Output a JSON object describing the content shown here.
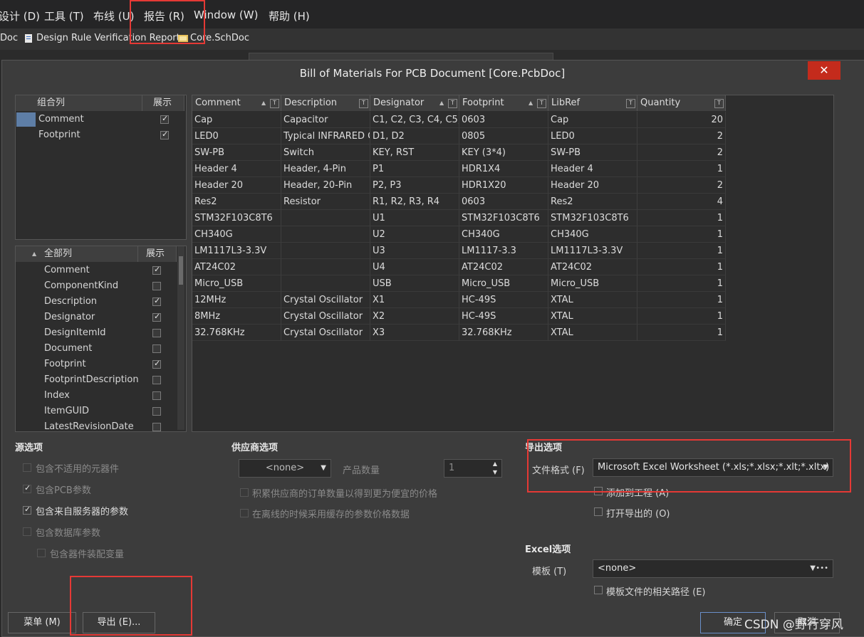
{
  "menubar": {
    "items": [
      "设计 (D)",
      "工具 (T)",
      "布线 (U)",
      "报告 (R)",
      "Window (W)",
      "帮助 (H)"
    ]
  },
  "tabs": [
    "Doc",
    "Design Rule Verification Report",
    "Core.SchDoc"
  ],
  "dialog": {
    "title": "Bill of Materials For PCB Document [Core.PcbDoc]",
    "close": "✕"
  },
  "grouped_columns": {
    "header_col": "组合列",
    "header_show": "展示",
    "items": [
      {
        "label": "Comment",
        "checked": true
      },
      {
        "label": "Footprint",
        "checked": true
      }
    ]
  },
  "all_columns": {
    "header_col": "全部列",
    "header_show": "展示",
    "items": [
      {
        "label": "Comment",
        "checked": true
      },
      {
        "label": "ComponentKind",
        "checked": false
      },
      {
        "label": "Description",
        "checked": true
      },
      {
        "label": "Designator",
        "checked": true
      },
      {
        "label": "DesignItemId",
        "checked": false
      },
      {
        "label": "Document",
        "checked": false
      },
      {
        "label": "Footprint",
        "checked": true
      },
      {
        "label": "FootprintDescription",
        "checked": false
      },
      {
        "label": "Index",
        "checked": false
      },
      {
        "label": "ItemGUID",
        "checked": false
      },
      {
        "label": "LatestRevisionDate",
        "checked": false
      }
    ]
  },
  "bom_table": {
    "columns": [
      "Comment",
      "Description",
      "Designator",
      "Footprint",
      "LibRef",
      "Quantity"
    ],
    "rows": [
      [
        "Cap",
        "Capacitor",
        "C1, C2, C3, C4, C5,",
        "0603",
        "Cap",
        "20"
      ],
      [
        "LED0",
        "Typical INFRARED G",
        "D1, D2",
        "0805",
        "LED0",
        "2"
      ],
      [
        "SW-PB",
        "Switch",
        "KEY, RST",
        "KEY (3*4)",
        "SW-PB",
        "2"
      ],
      [
        "Header 4",
        "Header, 4-Pin",
        "P1",
        "HDR1X4",
        "Header 4",
        "1"
      ],
      [
        "Header 20",
        "Header, 20-Pin",
        "P2, P3",
        "HDR1X20",
        "Header 20",
        "2"
      ],
      [
        "Res2",
        "Resistor",
        "R1, R2, R3, R4",
        "0603",
        "Res2",
        "4"
      ],
      [
        "STM32F103C8T6",
        "",
        "U1",
        "STM32F103C8T6",
        "STM32F103C8T6",
        "1"
      ],
      [
        "CH340G",
        "",
        "U2",
        "CH340G",
        "CH340G",
        "1"
      ],
      [
        "LM1117L3-3.3V",
        "",
        "U3",
        "LM1117-3.3",
        "LM1117L3-3.3V",
        "1"
      ],
      [
        "AT24C02",
        "",
        "U4",
        "AT24C02",
        "AT24C02",
        "1"
      ],
      [
        "Micro_USB",
        "",
        "USB",
        "Micro_USB",
        "Micro_USB",
        "1"
      ],
      [
        "12MHz",
        "Crystal Oscillator",
        "X1",
        "HC-49S",
        "XTAL",
        "1"
      ],
      [
        "8MHz",
        "Crystal Oscillator",
        "X2",
        "HC-49S",
        "XTAL",
        "1"
      ],
      [
        "32.768KHz",
        "Crystal Oscillator",
        "X3",
        "32.768KHz",
        "XTAL",
        "1"
      ]
    ]
  },
  "source_options": {
    "title": "源选项",
    "items": [
      {
        "label": "包含不适用的元器件",
        "checked": false,
        "enabled": false
      },
      {
        "label": "包含PCB参数",
        "checked": true,
        "enabled": false
      },
      {
        "label": "包含来自服务器的参数",
        "checked": true,
        "enabled": true
      },
      {
        "label": "包含数据库参数",
        "checked": false,
        "enabled": false
      },
      {
        "label": "包含器件装配变量",
        "checked": false,
        "enabled": false
      }
    ]
  },
  "supplier_options": {
    "title": "供应商选项",
    "select_value": "<none>",
    "qty_label": "产品数量",
    "qty_value": "1",
    "items": [
      {
        "label": "积累供应商的订单数量以得到更为便宜的价格",
        "checked": false
      },
      {
        "label": "在离线的时候采用缓存的参数价格数据",
        "checked": false
      }
    ]
  },
  "export_options": {
    "title": "导出选项",
    "format_label": "文件格式 (F)",
    "format_value": "Microsoft Excel Worksheet (*.xls;*.xlsx;*.xlt;*.xltx)",
    "add_to_project": "添加到工程 (A)",
    "open_exported": "打开导出的 (O)"
  },
  "excel_options": {
    "title": "Excel选项",
    "template_label": "模板 (T)",
    "template_value": "<none>",
    "relative_path": "模板文件的相关路径 (E)"
  },
  "buttons": {
    "menu": "菜单 (M)",
    "export": "导出 (E)...",
    "ok": "确定",
    "cancel": "取消"
  },
  "watermark": "CSDN @野行穿风",
  "colors": {
    "highlight": "#e53935",
    "close": "#c42b1c",
    "selected_row": "#5e7ea6"
  }
}
